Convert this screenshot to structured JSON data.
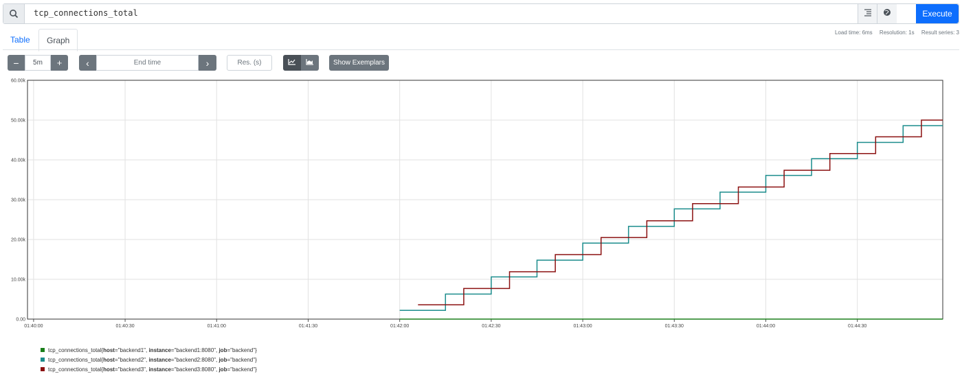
{
  "search": {
    "query": "tcp_connections_total",
    "execute_label": "Execute"
  },
  "tabs": [
    {
      "label": "Table"
    },
    {
      "label": "Graph"
    }
  ],
  "stats": {
    "load_time": "Load time: 6ms",
    "resolution": "Resolution: 1s",
    "result_series": "Result series: 3"
  },
  "controls": {
    "range_minus": "−",
    "range_value": "5m",
    "range_plus": "+",
    "prev": "‹",
    "end_time_placeholder": "End time",
    "next": "›",
    "res_placeholder": "Res. (s)",
    "line_icon": "line-chart-icon",
    "stacked_icon": "area-chart-icon",
    "exemplars_label": "Show Exemplars"
  },
  "legend": [
    {
      "prefix": "tcp_connections_total{",
      "host": "\"backend1\"",
      "instance": "\"backend1:8080\"",
      "job": "\"backend\"",
      "suffix": "}",
      "color": "#1a7f1a"
    },
    {
      "prefix": "tcp_connections_total{",
      "host": "\"backend2\"",
      "instance": "\"backend2:8080\"",
      "job": "\"backend\"",
      "suffix": "}",
      "color": "#1a8c8c"
    },
    {
      "prefix": "tcp_connections_total{",
      "host": "\"backend3\"",
      "instance": "\"backend3:8080\"",
      "job": "\"backend\"",
      "suffix": "}",
      "color": "#8b1010"
    }
  ],
  "chart_data": {
    "type": "line",
    "ylim": [
      0,
      60000
    ],
    "y_ticks": [
      "0.00",
      "10.00k",
      "20.00k",
      "30.00k",
      "40.00k",
      "50.00k",
      "60.00k"
    ],
    "x_ticks": [
      "01:40:00",
      "01:40:30",
      "01:41:00",
      "01:41:30",
      "01:42:00",
      "01:42:30",
      "01:43:00",
      "01:43:30",
      "01:44:00",
      "01:44:30"
    ],
    "xlim_seconds_from_0140": [
      -2,
      298
    ],
    "grid": true,
    "series": [
      {
        "name": "tcp_connections_total{host=\"backend1\", instance=\"backend1:8080\", job=\"backend\"}",
        "color": "#1a7f1a",
        "x": [
          120,
          298
        ],
        "y": [
          0,
          0
        ]
      },
      {
        "name": "tcp_connections_total{host=\"backend2\", instance=\"backend2:8080\", job=\"backend\"}",
        "color": "#1a8c8c",
        "steps": [
          [
            120,
            2200
          ],
          [
            135,
            6300
          ],
          [
            150,
            10600
          ],
          [
            165,
            14800
          ],
          [
            180,
            19100
          ],
          [
            195,
            23300
          ],
          [
            210,
            27700
          ],
          [
            225,
            31900
          ],
          [
            240,
            36100
          ],
          [
            255,
            40300
          ],
          [
            270,
            44400
          ],
          [
            285,
            48600
          ]
        ],
        "end": 298
      },
      {
        "name": "tcp_connections_total{host=\"backend3\", instance=\"backend3:8080\", job=\"backend\"}",
        "color": "#8b1010",
        "steps": [
          [
            126,
            3600
          ],
          [
            141,
            7700
          ],
          [
            156,
            11900
          ],
          [
            171,
            16200
          ],
          [
            186,
            20500
          ],
          [
            201,
            24700
          ],
          [
            216,
            29000
          ],
          [
            231,
            33200
          ],
          [
            246,
            37400
          ],
          [
            261,
            41600
          ],
          [
            276,
            45800
          ],
          [
            291,
            50000
          ]
        ],
        "end": 298
      }
    ]
  }
}
